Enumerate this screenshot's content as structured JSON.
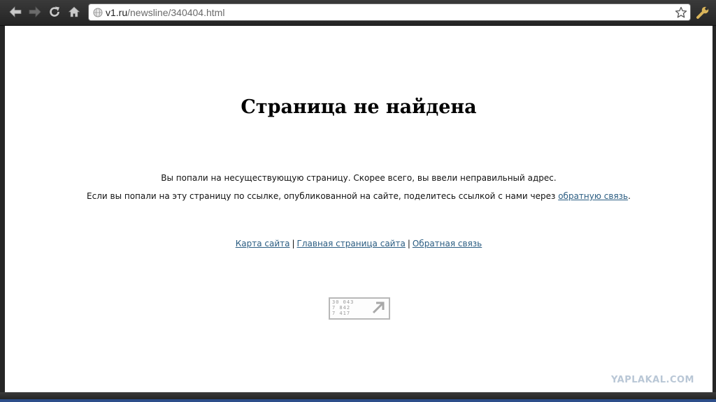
{
  "browser": {
    "address_bar": {
      "url_host": "v1.ru",
      "url_path": "/newsline/340404.html"
    },
    "icons": {
      "back": "back-arrow-icon",
      "forward": "forward-arrow-icon",
      "reload": "reload-icon",
      "home": "home-icon",
      "site": "globe-icon",
      "bookmark": "star-icon",
      "menu": "wrench-icon"
    }
  },
  "page": {
    "title": "Страница не найдена",
    "message_1": "Вы попали на несуществующую страницу. Скорее всего, вы ввели неправильный адрес.",
    "message_2_prefix": "Если вы попали на эту страницу по ссылке, опубликованной на сайте, поделитесь ссылкой с нами через ",
    "message_2_link": "обратную связь",
    "message_2_suffix": ".",
    "links": {
      "sitemap": "Карта сайта",
      "home": "Главная страница сайта",
      "feedback": "Обратная связь",
      "separator": "|"
    },
    "counter": {
      "line_1": "30 043",
      "line_2": "7 842",
      "line_3": "7 417"
    },
    "link_color": "#2b5d82"
  },
  "watermark": "YAPLAKAL.COM"
}
